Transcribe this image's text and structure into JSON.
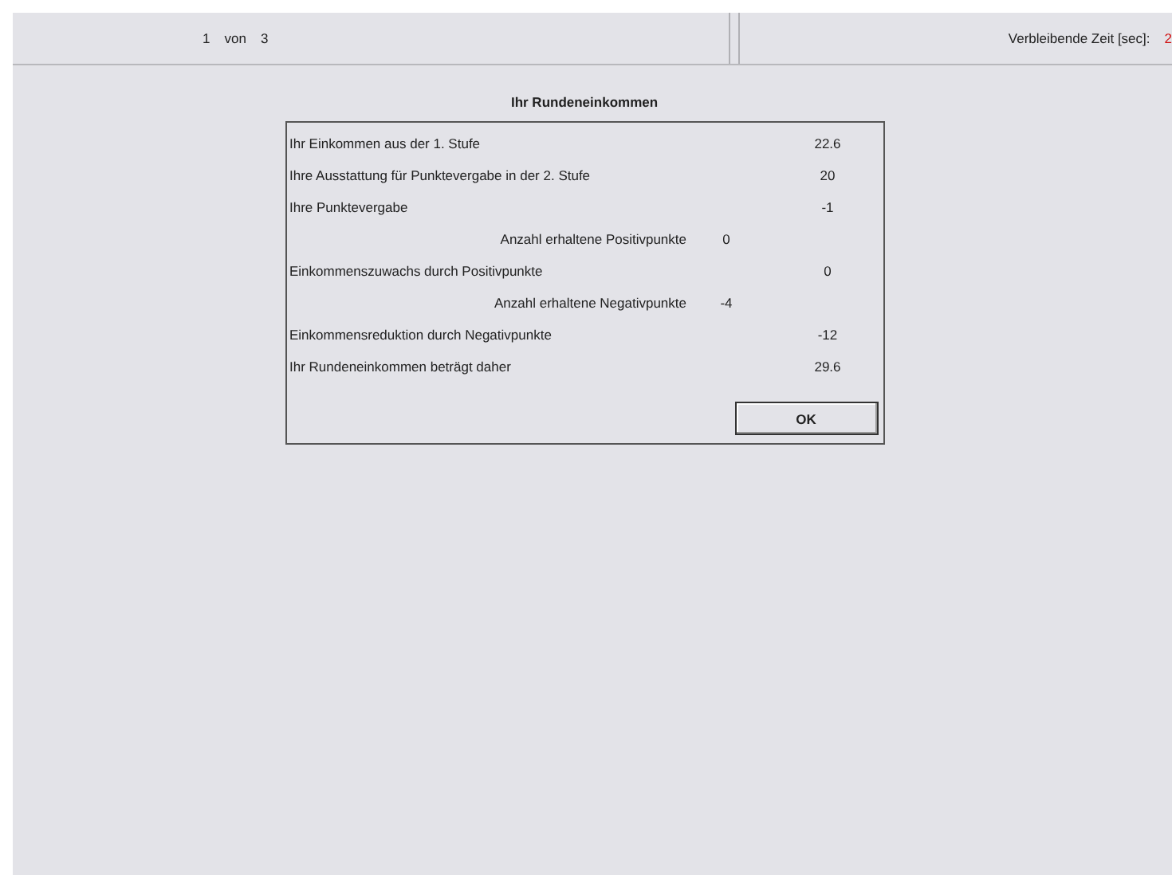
{
  "header": {
    "round": "1",
    "of": "von",
    "total": "3",
    "timer_label": "Verbleibende Zeit [sec]:",
    "timer_value": "2"
  },
  "dialog": {
    "title": "Ihr Rundeneinkommen",
    "rows": [
      {
        "kind": "main",
        "label": "Ihr Einkommen aus der 1. Stufe",
        "value": "22.6"
      },
      {
        "kind": "main",
        "label": "Ihre Ausstattung für Punktevergabe in der 2. Stufe",
        "value": "20"
      },
      {
        "kind": "main",
        "label": "Ihre Punktevergabe",
        "value": "-1"
      },
      {
        "kind": "sub",
        "label": "Anzahl erhaltene Positivpunkte",
        "value": "0"
      },
      {
        "kind": "main",
        "label": "Einkommenszuwachs durch Positivpunkte",
        "value": "0"
      },
      {
        "kind": "sub",
        "label": "Anzahl erhaltene Negativpunkte",
        "value": "-4"
      },
      {
        "kind": "main",
        "label": "Einkommensreduktion durch Negativpunkte",
        "value": "-12"
      },
      {
        "kind": "main",
        "label": "Ihr Rundeneinkommen beträgt daher",
        "value": "29.6"
      }
    ],
    "button": "OK"
  }
}
